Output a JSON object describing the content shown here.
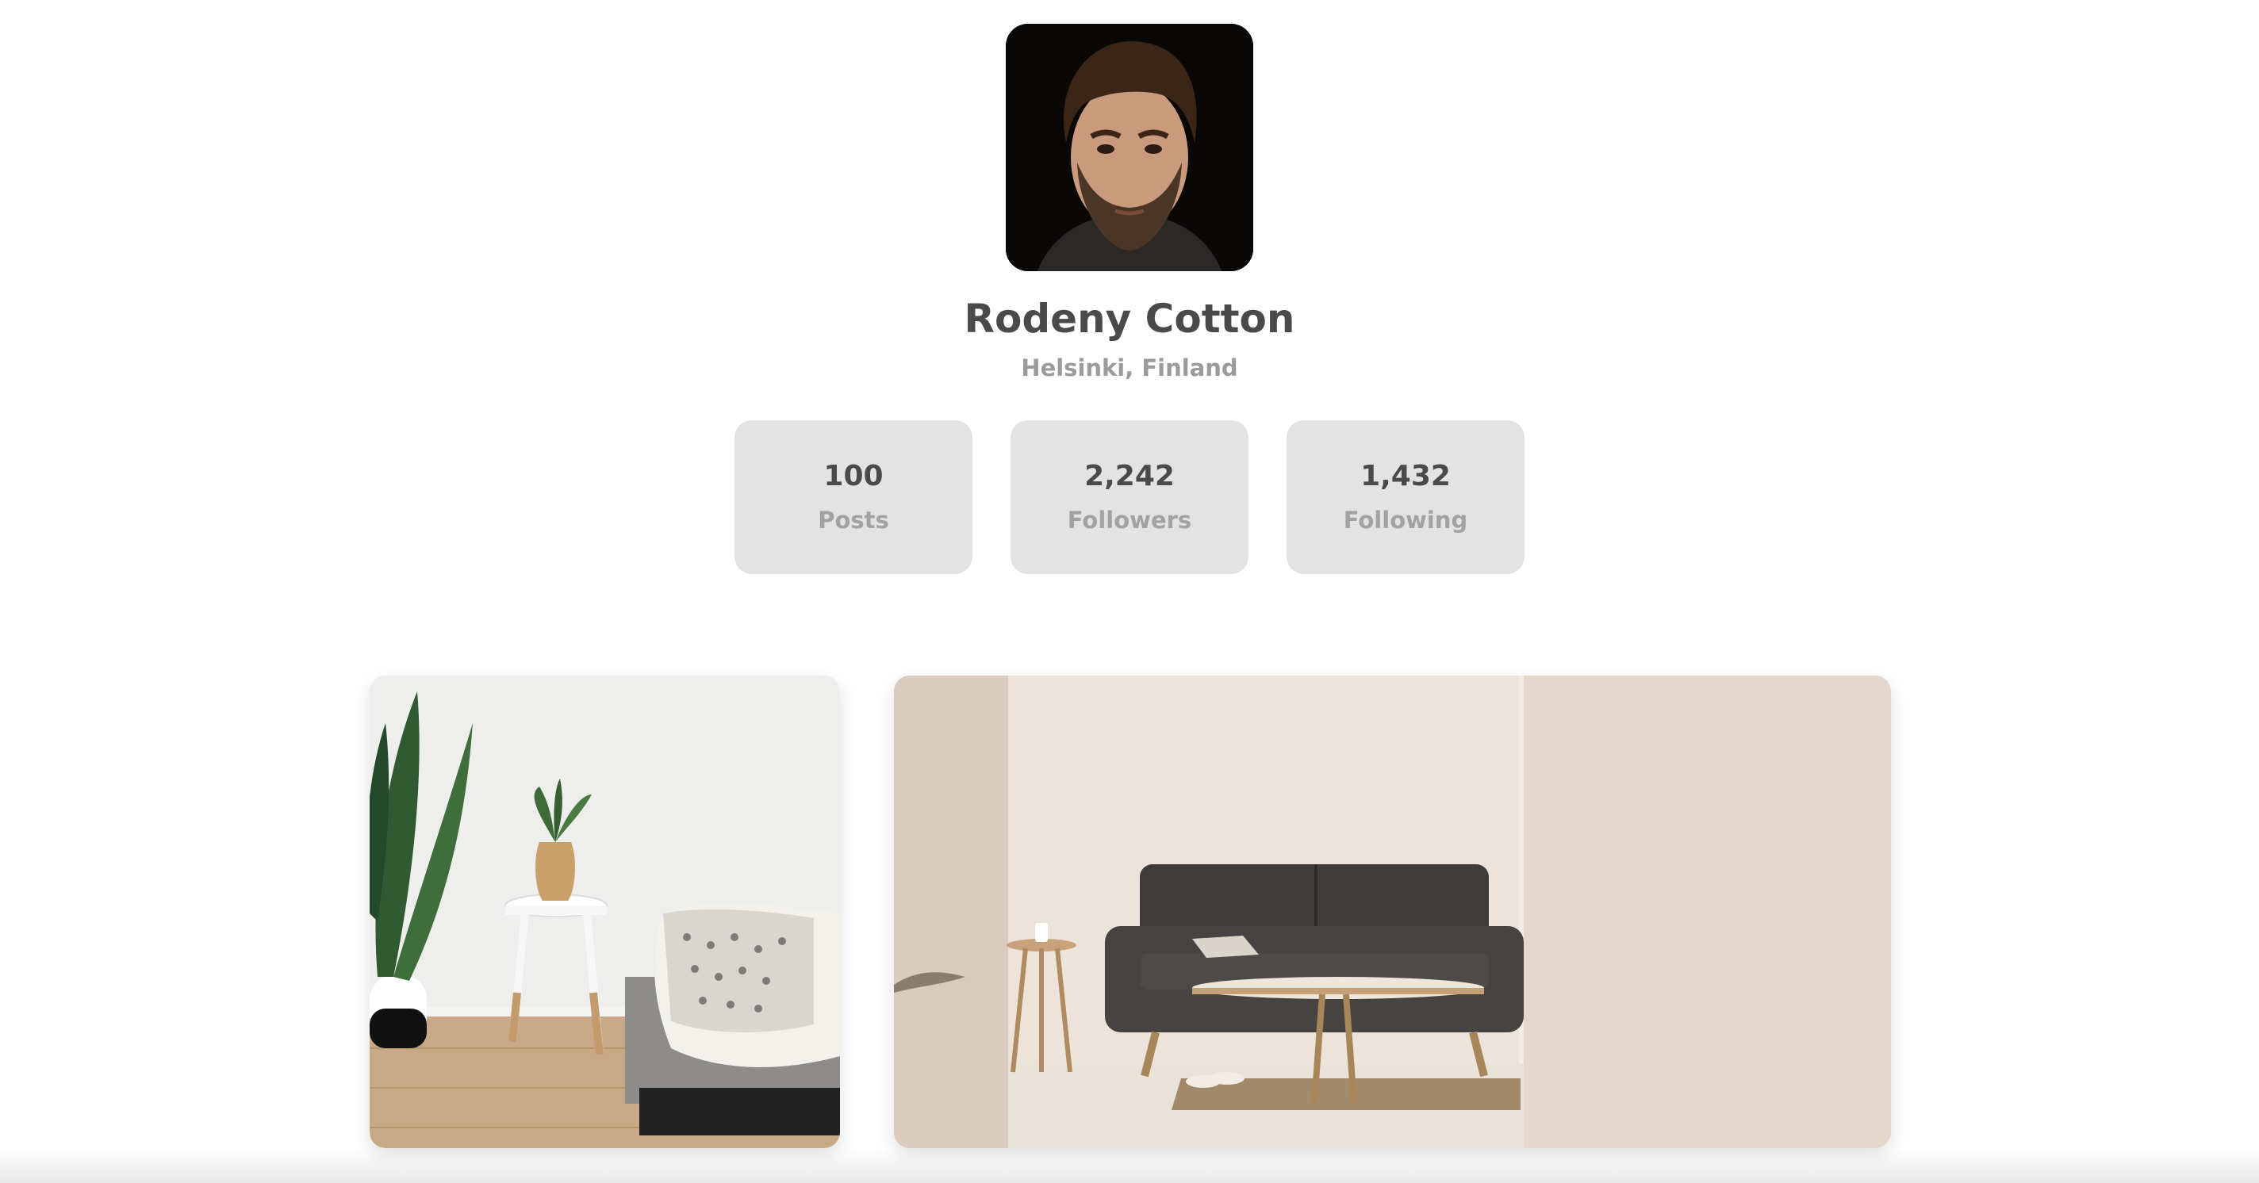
{
  "profile": {
    "name": "Rodeny Cotton",
    "location": "Helsinki, Finland"
  },
  "stats": [
    {
      "value": "100",
      "label": "Posts"
    },
    {
      "value": "2,242",
      "label": "Followers"
    },
    {
      "value": "1,432",
      "label": "Following"
    }
  ],
  "gallery": [
    {
      "subject": "living room with plant, side table and couch"
    },
    {
      "subject": "dark grey sofa with coffee table"
    }
  ],
  "colors": {
    "text_primary": "#4a4a4a",
    "text_secondary": "#9b9b9b",
    "card_bg": "#e3e3e3"
  }
}
